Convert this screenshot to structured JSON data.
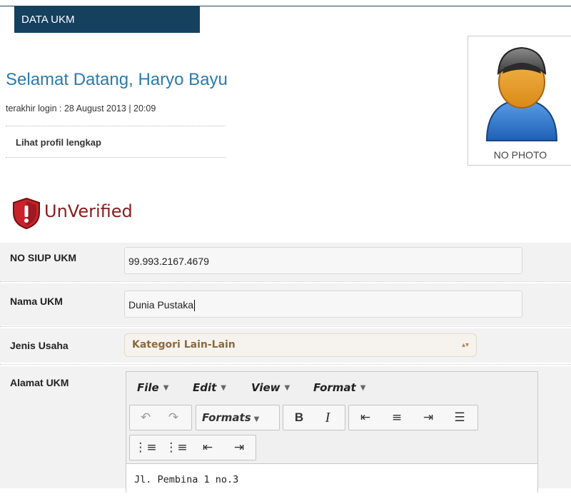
{
  "header": {
    "tab_label": "DATA UKM"
  },
  "welcome": {
    "greeting": "Selamat Datang, Haryo Bayu",
    "last_login": "terakhir login : 28 August 2013 | 20:09",
    "profile_link": "Lihat profil lengkap"
  },
  "photo": {
    "caption": "NO PHOTO",
    "icon": "user-silhouette-icon"
  },
  "status": {
    "label": "UnVerified",
    "icon": "shield-exclamation-icon",
    "color": "#8a1c1c"
  },
  "form": {
    "siup": {
      "label": "NO SIUP UKM",
      "value": "99.993.2167.4679"
    },
    "nama": {
      "label": "Nama UKM",
      "value": "Dunia Pustaka"
    },
    "jenis": {
      "label": "Jenis Usaha",
      "selected": "Kategori Lain-Lain"
    },
    "alamat": {
      "label": "Alamat UKM",
      "menus": [
        "File",
        "Edit",
        "View",
        "Format"
      ],
      "formats_label": "Formats",
      "content": "Jl. Pembina 1 no.3"
    }
  },
  "colors": {
    "accent": "#15415f",
    "link": "#2a7ab0",
    "select_text": "#8c6a3c"
  }
}
